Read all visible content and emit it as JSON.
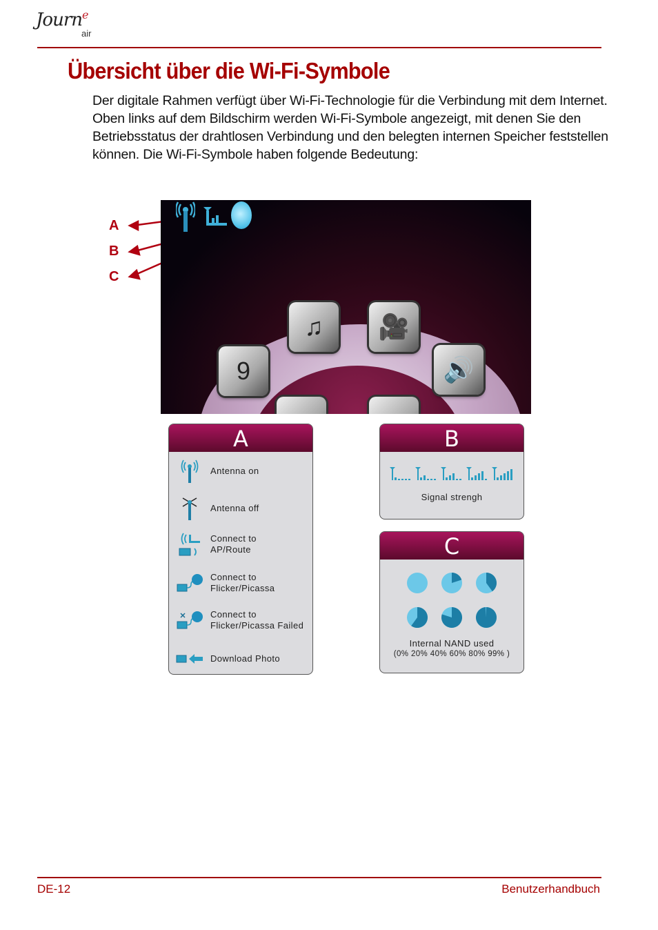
{
  "header": {
    "logo_script": "Journ",
    "logo_script_accent": "e",
    "logo_suffix": "air"
  },
  "page": {
    "title": "Übersicht über die Wi-Fi-Symbole",
    "intro": "Der digitale Rahmen verfügt über Wi-Fi-Technologie für die Verbindung mit dem Internet. Oben links auf dem Bildschirm werden Wi-Fi-Symbole angezeigt, mit denen Sie den Betriebsstatus der drahtlosen Verbindung und den belegten internen Speicher feststellen können. Die Wi-Fi-Symbole haben folgende Bedeutung:"
  },
  "figure": {
    "callouts": [
      "A",
      "B",
      "C"
    ],
    "status_icons": [
      "antenna-on-icon",
      "signal-strength-icon",
      "nand-usage-icon"
    ],
    "app_tiles": [
      {
        "name": "calendar-app",
        "glyph": "9"
      },
      {
        "name": "photo-music-app",
        "glyph": "♫"
      },
      {
        "name": "video-app",
        "glyph": "🎥"
      },
      {
        "name": "speaker-app",
        "glyph": "🔊"
      }
    ],
    "accent_color": "#2a9ec2",
    "callout_color": "#b00010"
  },
  "panels": {
    "a": {
      "header": "A",
      "items": [
        {
          "icon": "antenna-on-icon",
          "label": "Antenna on"
        },
        {
          "icon": "antenna-off-icon",
          "label": "Antenna off"
        },
        {
          "icon": "connect-ap-icon",
          "label": "Connect to\nAP/Route"
        },
        {
          "icon": "connect-flickr-icon",
          "label": "Connect to\nFlicker/Picassa"
        },
        {
          "icon": "connect-flickr-failed-icon",
          "label": "Connect to\nFlicker/Picassa Failed"
        },
        {
          "icon": "download-photo-icon",
          "label": "Download Photo"
        }
      ]
    },
    "b": {
      "header": "B",
      "signal_levels": [
        1,
        2,
        3,
        4,
        5
      ],
      "caption": "Signal strengh"
    },
    "c": {
      "header": "C",
      "usage_percent": [
        0,
        20,
        40,
        60,
        80,
        99
      ],
      "caption": "Internal NAND used",
      "subcaption": "(0% 20% 40% 60% 80% 99% )"
    },
    "header_color": "#8a0f45",
    "panel_bg": "#dcdcdf"
  },
  "footer": {
    "page_number": "DE-12",
    "manual_name": "Benutzerhandbuch"
  }
}
